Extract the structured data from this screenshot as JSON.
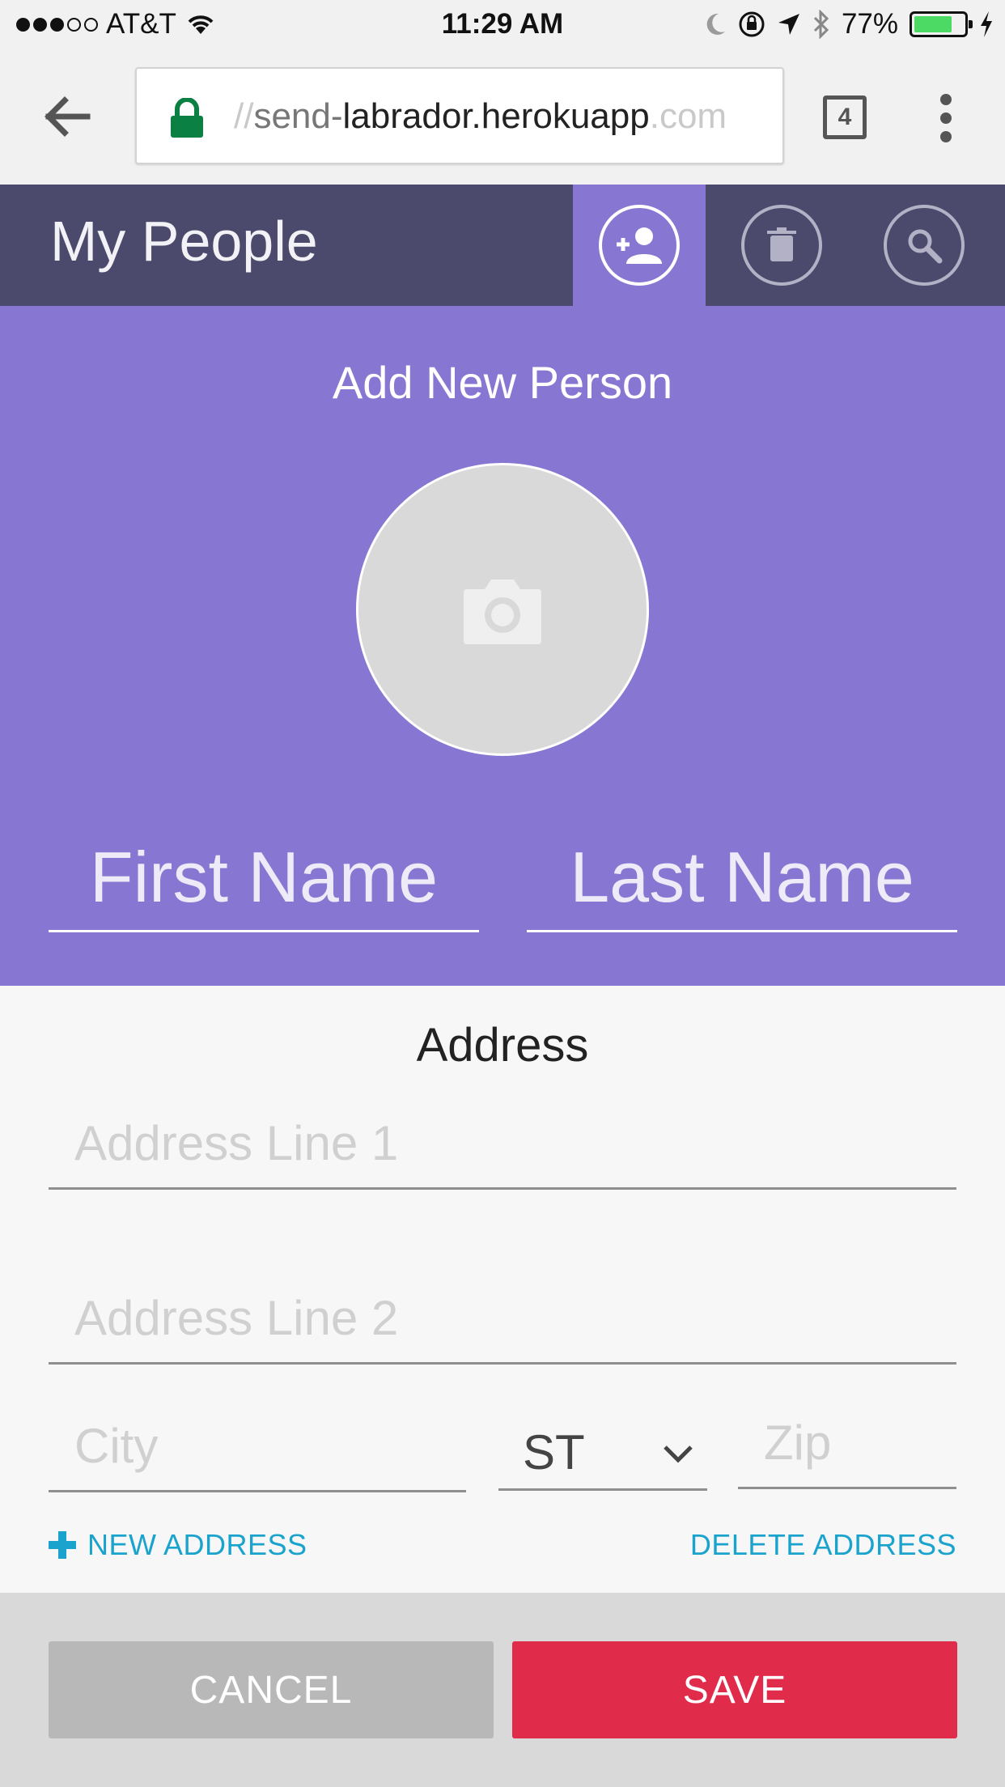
{
  "status_bar": {
    "carrier": "AT&T",
    "time": "11:29 AM",
    "battery": "77%",
    "signal_bars_filled": 3,
    "signal_bars_total": 5,
    "battery_level": 0.77,
    "battery_color": "#4cd964"
  },
  "browser": {
    "url_prefix": "//",
    "url_sub": "send-",
    "url_host": "labrador.herokuapp",
    "url_tld": ".com",
    "tab_count": "4"
  },
  "app_header": {
    "title": "My People",
    "icons": [
      "add-person-icon",
      "trash-icon",
      "search-icon"
    ],
    "background": "#4c4a6c",
    "active_background": "#8877d2"
  },
  "person_form": {
    "title": "Add New Person",
    "photo_icon": "camera-icon",
    "first_name_placeholder": "First Name",
    "last_name_placeholder": "Last Name",
    "background": "#8877d2"
  },
  "address": {
    "title": "Address",
    "line1_placeholder": "Address Line 1",
    "line2_placeholder": "Address Line 2",
    "city_placeholder": "City",
    "state_value": "ST",
    "zip_placeholder": "Zip",
    "new_address_label": "NEW ADDRESS",
    "delete_address_label": "DELETE ADDRESS",
    "link_color": "#1aa3cc"
  },
  "footer": {
    "cancel_label": "CANCEL",
    "save_label": "SAVE",
    "save_color": "#e12b4b",
    "cancel_color": "#b8b8b8"
  }
}
